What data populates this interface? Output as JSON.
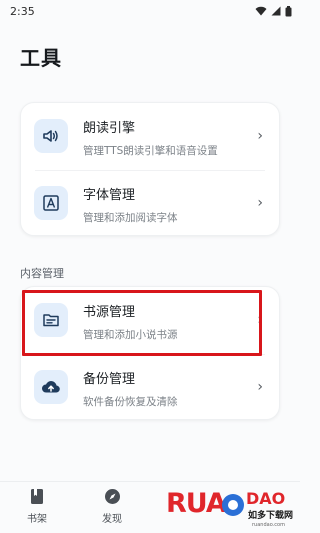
{
  "status_bar": {
    "time": "2:35",
    "icons": [
      "wifi-icon",
      "cell-signal-icon",
      "battery-icon"
    ]
  },
  "page": {
    "title": "工具"
  },
  "card_1": {
    "items": [
      {
        "title": "朗读引擎",
        "subtitle": "管理TTS朗读引擎和语音设置",
        "icon": "speaker-icon"
      },
      {
        "title": "字体管理",
        "subtitle": "管理和添加阅读字体",
        "icon": "font-icon"
      }
    ]
  },
  "section": {
    "label": "内容管理"
  },
  "card_2": {
    "items": [
      {
        "title": "书源管理",
        "subtitle": "管理和添加小说书源",
        "icon": "source-list-icon"
      },
      {
        "title": "备份管理",
        "subtitle": "软件备份恢复及清除",
        "icon": "cloud-upload-icon"
      }
    ]
  },
  "chevron": "›",
  "bottom_nav": {
    "items": [
      {
        "label": "书架",
        "icon": "book-icon"
      },
      {
        "label": "发现",
        "icon": "compass-icon"
      }
    ]
  },
  "watermark": {
    "brand": "RUANDAO",
    "tagline": "如多下载网",
    "url": "ruandao.com"
  },
  "colors": {
    "accent": "#1f3b5c",
    "icon_bg": "#e3eefb",
    "highlight": "#d8161b",
    "watermark_red": "#e0262b",
    "watermark_blue": "#2a6fd6"
  }
}
